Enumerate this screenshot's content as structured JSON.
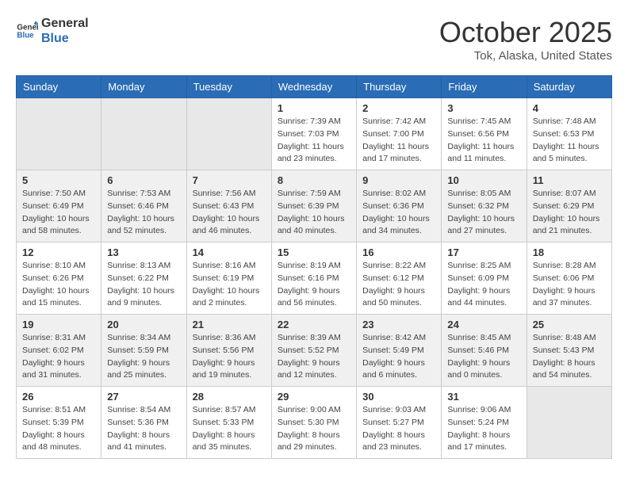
{
  "logo": {
    "text1": "General",
    "text2": "Blue"
  },
  "title": "October 2025",
  "location": "Tok, Alaska, United States",
  "weekdays": [
    "Sunday",
    "Monday",
    "Tuesday",
    "Wednesday",
    "Thursday",
    "Friday",
    "Saturday"
  ],
  "weeks": [
    [
      {
        "day": "",
        "info": ""
      },
      {
        "day": "",
        "info": ""
      },
      {
        "day": "",
        "info": ""
      },
      {
        "day": "1",
        "info": "Sunrise: 7:39 AM\nSunset: 7:03 PM\nDaylight: 11 hours\nand 23 minutes."
      },
      {
        "day": "2",
        "info": "Sunrise: 7:42 AM\nSunset: 7:00 PM\nDaylight: 11 hours\nand 17 minutes."
      },
      {
        "day": "3",
        "info": "Sunrise: 7:45 AM\nSunset: 6:56 PM\nDaylight: 11 hours\nand 11 minutes."
      },
      {
        "day": "4",
        "info": "Sunrise: 7:48 AM\nSunset: 6:53 PM\nDaylight: 11 hours\nand 5 minutes."
      }
    ],
    [
      {
        "day": "5",
        "info": "Sunrise: 7:50 AM\nSunset: 6:49 PM\nDaylight: 10 hours\nand 58 minutes."
      },
      {
        "day": "6",
        "info": "Sunrise: 7:53 AM\nSunset: 6:46 PM\nDaylight: 10 hours\nand 52 minutes."
      },
      {
        "day": "7",
        "info": "Sunrise: 7:56 AM\nSunset: 6:43 PM\nDaylight: 10 hours\nand 46 minutes."
      },
      {
        "day": "8",
        "info": "Sunrise: 7:59 AM\nSunset: 6:39 PM\nDaylight: 10 hours\nand 40 minutes."
      },
      {
        "day": "9",
        "info": "Sunrise: 8:02 AM\nSunset: 6:36 PM\nDaylight: 10 hours\nand 34 minutes."
      },
      {
        "day": "10",
        "info": "Sunrise: 8:05 AM\nSunset: 6:32 PM\nDaylight: 10 hours\nand 27 minutes."
      },
      {
        "day": "11",
        "info": "Sunrise: 8:07 AM\nSunset: 6:29 PM\nDaylight: 10 hours\nand 21 minutes."
      }
    ],
    [
      {
        "day": "12",
        "info": "Sunrise: 8:10 AM\nSunset: 6:26 PM\nDaylight: 10 hours\nand 15 minutes."
      },
      {
        "day": "13",
        "info": "Sunrise: 8:13 AM\nSunset: 6:22 PM\nDaylight: 10 hours\nand 9 minutes."
      },
      {
        "day": "14",
        "info": "Sunrise: 8:16 AM\nSunset: 6:19 PM\nDaylight: 10 hours\nand 2 minutes."
      },
      {
        "day": "15",
        "info": "Sunrise: 8:19 AM\nSunset: 6:16 PM\nDaylight: 9 hours\nand 56 minutes."
      },
      {
        "day": "16",
        "info": "Sunrise: 8:22 AM\nSunset: 6:12 PM\nDaylight: 9 hours\nand 50 minutes."
      },
      {
        "day": "17",
        "info": "Sunrise: 8:25 AM\nSunset: 6:09 PM\nDaylight: 9 hours\nand 44 minutes."
      },
      {
        "day": "18",
        "info": "Sunrise: 8:28 AM\nSunset: 6:06 PM\nDaylight: 9 hours\nand 37 minutes."
      }
    ],
    [
      {
        "day": "19",
        "info": "Sunrise: 8:31 AM\nSunset: 6:02 PM\nDaylight: 9 hours\nand 31 minutes."
      },
      {
        "day": "20",
        "info": "Sunrise: 8:34 AM\nSunset: 5:59 PM\nDaylight: 9 hours\nand 25 minutes."
      },
      {
        "day": "21",
        "info": "Sunrise: 8:36 AM\nSunset: 5:56 PM\nDaylight: 9 hours\nand 19 minutes."
      },
      {
        "day": "22",
        "info": "Sunrise: 8:39 AM\nSunset: 5:52 PM\nDaylight: 9 hours\nand 12 minutes."
      },
      {
        "day": "23",
        "info": "Sunrise: 8:42 AM\nSunset: 5:49 PM\nDaylight: 9 hours\nand 6 minutes."
      },
      {
        "day": "24",
        "info": "Sunrise: 8:45 AM\nSunset: 5:46 PM\nDaylight: 9 hours\nand 0 minutes."
      },
      {
        "day": "25",
        "info": "Sunrise: 8:48 AM\nSunset: 5:43 PM\nDaylight: 8 hours\nand 54 minutes."
      }
    ],
    [
      {
        "day": "26",
        "info": "Sunrise: 8:51 AM\nSunset: 5:39 PM\nDaylight: 8 hours\nand 48 minutes."
      },
      {
        "day": "27",
        "info": "Sunrise: 8:54 AM\nSunset: 5:36 PM\nDaylight: 8 hours\nand 41 minutes."
      },
      {
        "day": "28",
        "info": "Sunrise: 8:57 AM\nSunset: 5:33 PM\nDaylight: 8 hours\nand 35 minutes."
      },
      {
        "day": "29",
        "info": "Sunrise: 9:00 AM\nSunset: 5:30 PM\nDaylight: 8 hours\nand 29 minutes."
      },
      {
        "day": "30",
        "info": "Sunrise: 9:03 AM\nSunset: 5:27 PM\nDaylight: 8 hours\nand 23 minutes."
      },
      {
        "day": "31",
        "info": "Sunrise: 9:06 AM\nSunset: 5:24 PM\nDaylight: 8 hours\nand 17 minutes."
      },
      {
        "day": "",
        "info": ""
      }
    ]
  ]
}
